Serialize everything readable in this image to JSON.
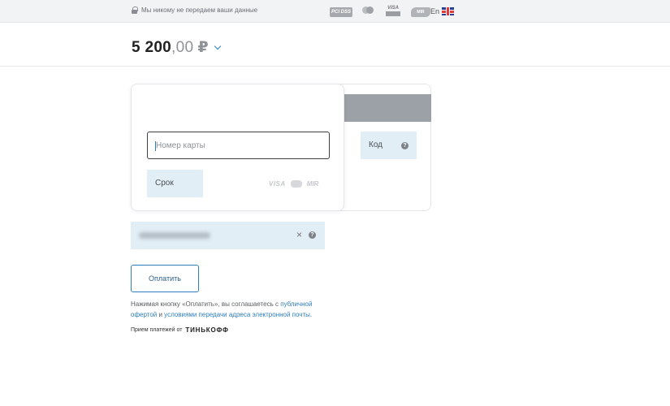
{
  "topbar": {
    "secure_text": "Мы никому не передаем ваши данные",
    "badges": {
      "pci": "PCI DSS",
      "mastercard": "Mastercard SecureCode",
      "visa": "VISA",
      "mir": "MIR"
    },
    "lang": "En"
  },
  "amount": {
    "integer": "5 200",
    "decimals": ",00",
    "currency": "₽"
  },
  "card": {
    "number_placeholder": "Номер карты",
    "expiry_label": "Срок",
    "cvc_label": "Код",
    "brands": [
      "VISA",
      "MIR"
    ]
  },
  "email": {
    "value_hidden": ""
  },
  "icons": {
    "help": "?",
    "clear": "×"
  },
  "pay_button": "Оплатить",
  "agreement": {
    "text_1": "Нажимая кнопку «Оплатить», вы соглашаетесь с ",
    "link_offer": "публичной офертой",
    "text_2": " и ",
    "link_terms": "условиями передачи адреса электронной почты",
    "text_3": "."
  },
  "provider": {
    "label": "Прием платежей от",
    "name": "ТИНЬКОФФ"
  },
  "colors": {
    "accent": "#2f7fc0",
    "field_bg": "#e2eef5",
    "stripe": "#9ca1a8"
  }
}
